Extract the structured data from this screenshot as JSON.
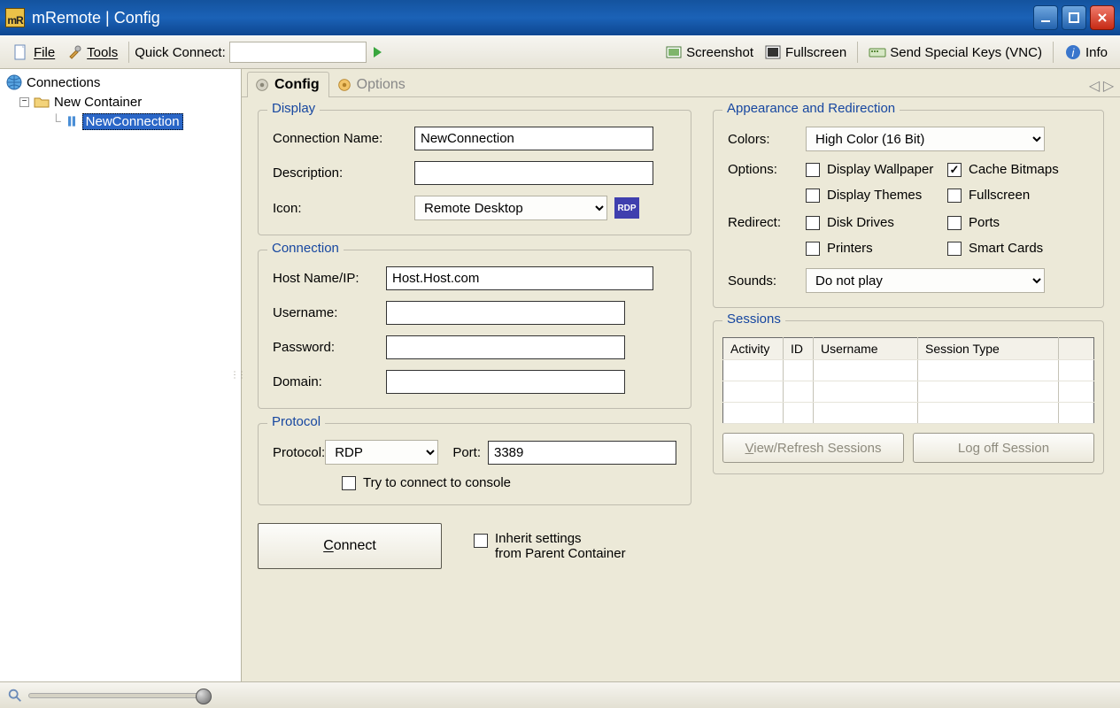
{
  "window": {
    "title": "mRemote | Config"
  },
  "menubar": {
    "file": "File",
    "tools": "Tools",
    "quick_connect_label": "Quick Connect:",
    "quick_connect_value": "",
    "screenshot": "Screenshot",
    "fullscreen": "Fullscreen",
    "send_keys": "Send Special Keys (VNC)",
    "info": "Info"
  },
  "sidebar": {
    "root": "Connections",
    "container": "New Container",
    "connection": "NewConnection"
  },
  "tabs": {
    "config": "Config",
    "options": "Options"
  },
  "display_group": {
    "legend": "Display",
    "connection_name_label": "Connection Name:",
    "connection_name_value": "NewConnection",
    "description_label": "Description:",
    "description_value": "",
    "icon_label": "Icon:",
    "icon_value": "Remote Desktop",
    "icon_badge": "RDP"
  },
  "connection_group": {
    "legend": "Connection",
    "host_label": "Host Name/IP:",
    "host_value": "Host.Host.com",
    "username_label": "Username:",
    "username_value": "",
    "password_label": "Password:",
    "password_value": "",
    "domain_label": "Domain:",
    "domain_value": ""
  },
  "protocol_group": {
    "legend": "Protocol",
    "protocol_label": "Protocol:",
    "protocol_value": "RDP",
    "port_label": "Port:",
    "port_value": "3389",
    "try_console": "Try to connect to console"
  },
  "connect_button": "Connect",
  "inherit_label_line1": "Inherit settings",
  "inherit_label_line2": "from Parent Container",
  "appearance_group": {
    "legend": "Appearance and Redirection",
    "colors_label": "Colors:",
    "colors_value": "High Color (16 Bit)",
    "options_label": "Options:",
    "display_wallpaper": "Display Wallpaper",
    "cache_bitmaps": "Cache Bitmaps",
    "display_themes": "Display Themes",
    "fullscreen": "Fullscreen",
    "redirect_label": "Redirect:",
    "disk_drives": "Disk Drives",
    "ports": "Ports",
    "printers": "Printers",
    "smart_cards": "Smart Cards",
    "sounds_label": "Sounds:",
    "sounds_value": "Do not play"
  },
  "sessions_group": {
    "legend": "Sessions",
    "col_activity": "Activity",
    "col_id": "ID",
    "col_username": "Username",
    "col_type": "Session Type",
    "view_refresh": "View/Refresh Sessions",
    "logoff": "Log off Session"
  }
}
